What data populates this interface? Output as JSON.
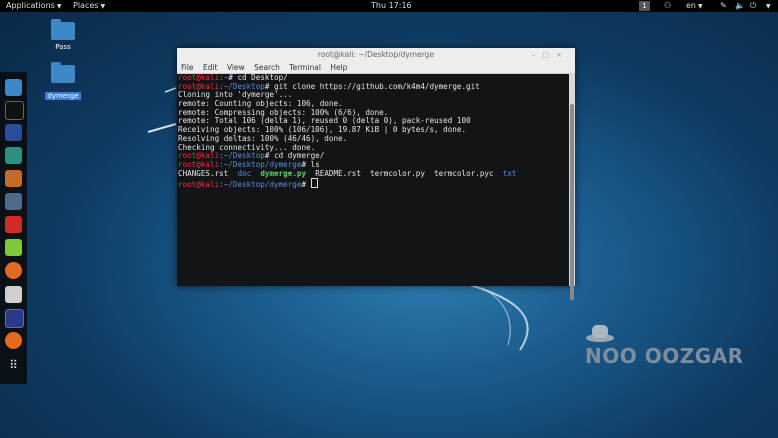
{
  "topbar": {
    "applications": "Applications",
    "places": "Places",
    "clock": "Thu 17:16",
    "workspace": "1",
    "language": "en"
  },
  "desktop": {
    "icons": [
      {
        "label": "Pass"
      },
      {
        "label": "dymerge"
      }
    ]
  },
  "terminal": {
    "title": "root@kali: ~/Desktop/dymerge",
    "menu": [
      "File",
      "Edit",
      "View",
      "Search",
      "Terminal",
      "Help"
    ],
    "prompt_user": "root@kali",
    "lines": [
      {
        "kind": "prompt",
        "path": ":~",
        "cmd": "# cd Desktop/"
      },
      {
        "kind": "prompt",
        "path": ":~/Desktop",
        "cmd": "# git clone https://github.com/k4m4/dymerge.git"
      },
      {
        "kind": "out",
        "text": "Cloning into 'dymerge'..."
      },
      {
        "kind": "out",
        "text": "remote: Counting objects: 106, done."
      },
      {
        "kind": "out",
        "text": "remote: Compressing objects: 100% (6/6), done."
      },
      {
        "kind": "out",
        "text": "remote: Total 106 (delta 1), reused 0 (delta 0), pack-reused 100"
      },
      {
        "kind": "out",
        "text": "Receiving objects: 100% (106/106), 19.87 KiB | 0 bytes/s, done."
      },
      {
        "kind": "out",
        "text": "Resolving deltas: 100% (46/46), done."
      },
      {
        "kind": "out",
        "text": "Checking connectivity... done."
      },
      {
        "kind": "prompt",
        "path": ":~/Desktop",
        "cmd": "# cd dymerge/"
      },
      {
        "kind": "prompt",
        "path": ":~/Desktop/dymerge",
        "cmd": "# ls"
      }
    ],
    "ls": [
      {
        "name": "CHANGES.rst",
        "type": "file"
      },
      {
        "name": "doc",
        "type": "dir"
      },
      {
        "name": "dymerge.py",
        "type": "exe"
      },
      {
        "name": "README.rst",
        "type": "file"
      },
      {
        "name": "termcolor.py",
        "type": "file"
      },
      {
        "name": "termcolor.pyc",
        "type": "file"
      },
      {
        "name": "txt",
        "type": "dir"
      }
    ],
    "final_prompt": {
      "path": ":~/Desktop/dymerge",
      "cmd": "# "
    }
  },
  "watermark": {
    "text": "NOO OOZGAR"
  },
  "colors": {
    "accent_blue": "#3b7dd8",
    "prompt_red": "#ee3333",
    "path_blue": "#5e8cd8",
    "exe_green": "#5fd35f"
  }
}
